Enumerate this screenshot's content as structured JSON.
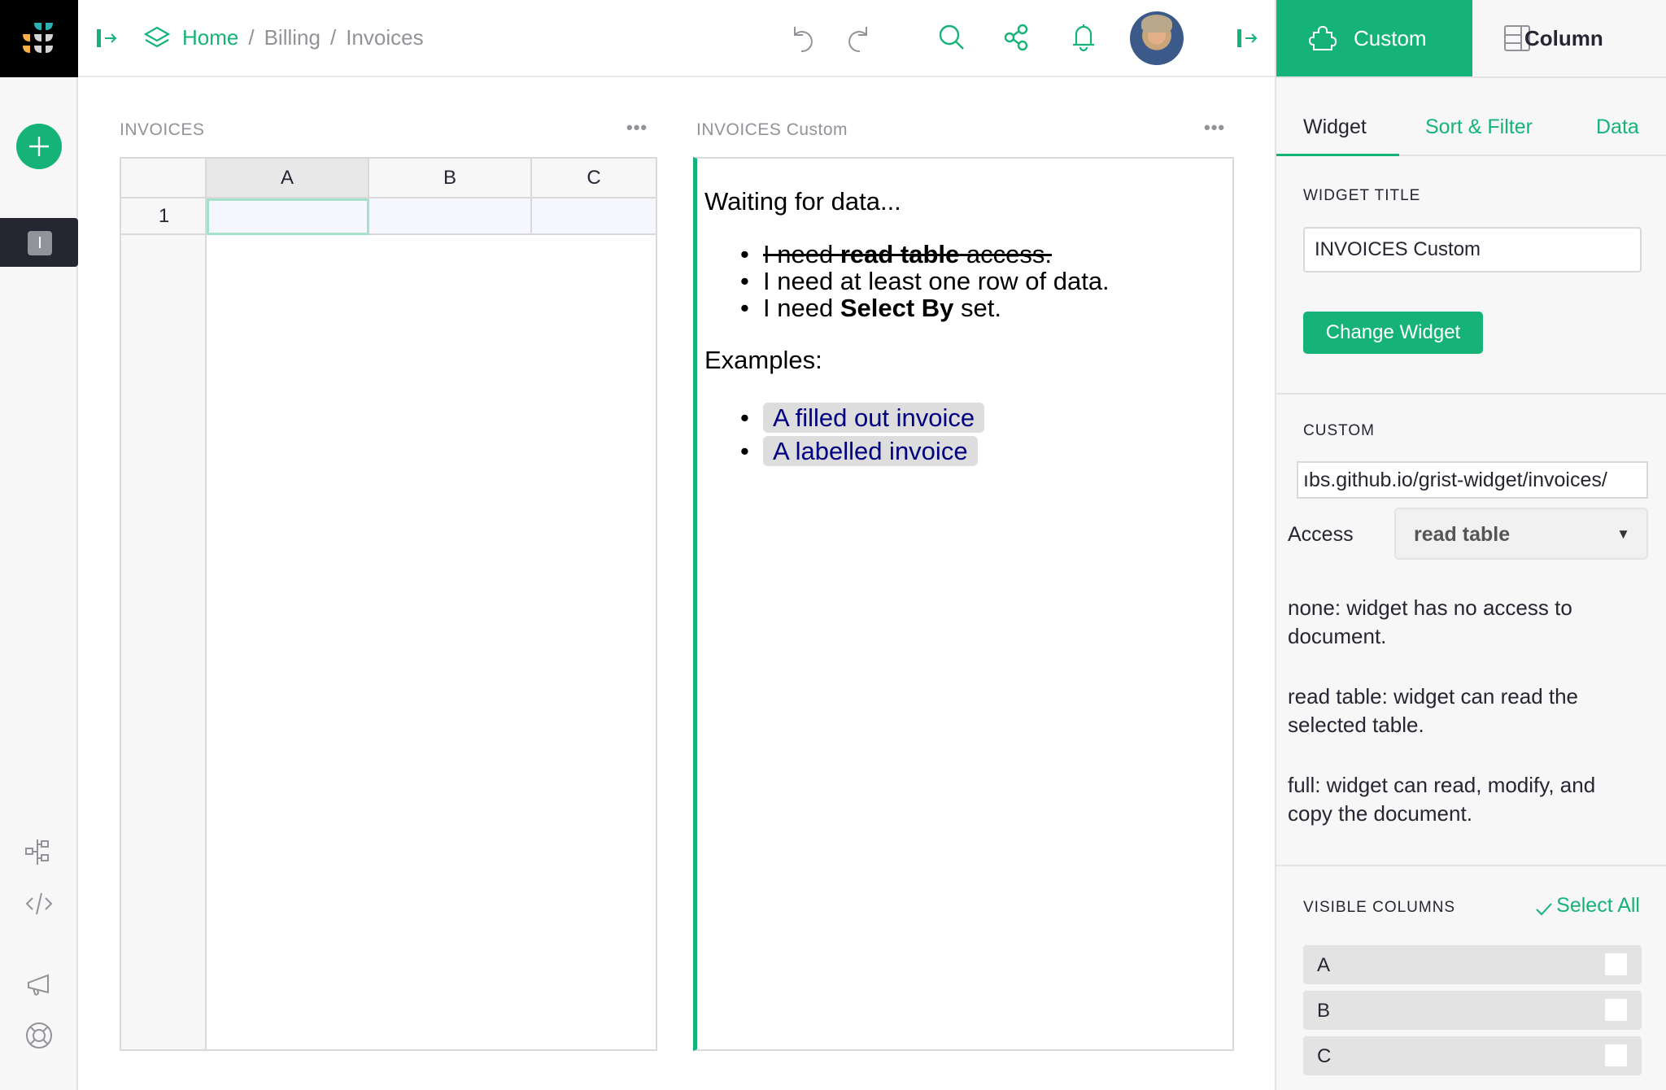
{
  "topbar": {
    "breadcrumbs": {
      "home": "Home",
      "separator": "/",
      "items": [
        "Billing",
        "Invoices"
      ]
    },
    "icons": {
      "logo": "grist-logo",
      "collapse_left": "panel-expand-icon",
      "workspace": "layers-icon",
      "undo": "undo-icon",
      "redo": "redo-icon",
      "search": "search-icon",
      "share": "share-icon",
      "notifications": "bell-icon",
      "avatar": "user-avatar",
      "collapse_right": "panel-expand-icon"
    }
  },
  "leftbar": {
    "add_button_icon": "plus-icon",
    "pages": [
      {
        "initial": "I",
        "selected": true
      }
    ],
    "bottom_icons": [
      "raw-data-icon",
      "code-view-icon",
      "megaphone-icon",
      "help-lifebuoy-icon"
    ]
  },
  "grid_section": {
    "title": "INVOICES",
    "menu_icon": "more-dots-icon",
    "columns": [
      "A",
      "B",
      "C"
    ],
    "rows": [
      {
        "num": "1",
        "cells": [
          "",
          "",
          ""
        ]
      }
    ]
  },
  "custom_section": {
    "title": "INVOICES Custom",
    "menu_icon": "more-dots-icon",
    "waiting": "Waiting for data...",
    "requirements": [
      {
        "prefix": "I need ",
        "bold": "read table",
        "suffix": " access.",
        "struck": true
      },
      {
        "prefix": "I need at least one row of data.",
        "bold": "",
        "suffix": "",
        "struck": false
      },
      {
        "prefix": "I need ",
        "bold": "Select By",
        "suffix": " set.",
        "struck": false
      }
    ],
    "examples_label": "Examples:",
    "examples": [
      "A filled out invoice",
      "A labelled invoice"
    ]
  },
  "right_panel": {
    "tabs": {
      "custom": "Custom",
      "column": "Column"
    },
    "subtabs": [
      "Widget",
      "Sort & Filter",
      "Data"
    ],
    "active_subtab": "Widget",
    "widget_title_label": "WIDGET TITLE",
    "widget_title_value": "INVOICES Custom",
    "change_widget": "Change Widget",
    "custom_label": "CUSTOM",
    "url_value": "ubs.github.io/grist-widget/invoices/",
    "url_visible": "ıbs.github.io/grist-widget/invoices/",
    "access_label": "Access",
    "access_value": "read table",
    "access_descriptions": [
      "none: widget has no access to document.",
      "read table: widget can read the selected table.",
      "full: widget can read, modify, and copy the document."
    ],
    "visible_columns_label": "VISIBLE COLUMNS",
    "select_all": "Select All",
    "visible_columns": [
      {
        "name": "A",
        "checked": false
      },
      {
        "name": "B",
        "checked": false
      },
      {
        "name": "C",
        "checked": false
      }
    ]
  },
  "colors": {
    "accent": "#16b378",
    "dark": "#262633",
    "muted": "#929299",
    "logo_teal": "#2bb1b1",
    "logo_orange": "#fbb047",
    "logo_gray": "#d4d4d4"
  }
}
